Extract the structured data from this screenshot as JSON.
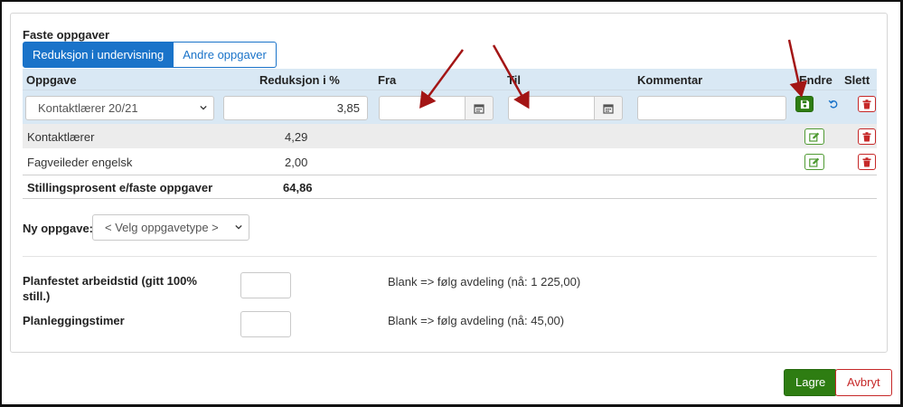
{
  "section": {
    "title": "Faste oppgaver"
  },
  "tabs": [
    {
      "label": "Reduksjon i undervisning",
      "active": true
    },
    {
      "label": "Andre oppgaver",
      "active": false
    }
  ],
  "table": {
    "headers": {
      "oppgave": "Oppgave",
      "reduksjon": "Reduksjon i %",
      "fra": "Fra",
      "til": "Til",
      "kommentar": "Kommentar",
      "endre": "Endre",
      "slett": "Slett"
    },
    "edit_row": {
      "oppgave_selected": "Kontaktlærer 20/21",
      "reduksjon_value": "3,85",
      "fra_value": "",
      "til_value": "",
      "kommentar_value": ""
    },
    "rows": [
      {
        "oppgave": "Kontaktlærer",
        "reduksjon": "4,29"
      },
      {
        "oppgave": "Fagveileder engelsk",
        "reduksjon": "2,00"
      }
    ],
    "total": {
      "label": "Stillingsprosent e/faste oppgaver",
      "value": "64,86"
    }
  },
  "ny_oppgave": {
    "label": "Ny oppgave:",
    "selected": "< Velg oppgavetype >"
  },
  "planning": [
    {
      "label": "Planfestet arbeidstid (gitt 100% still.)",
      "value": "",
      "hint": "Blank => følg avdeling (nå: 1 225,00)"
    },
    {
      "label": "Planleggingstimer",
      "value": "",
      "hint": "Blank => følg avdeling (nå: 45,00)"
    }
  ],
  "footer": {
    "save_label": "Lagre",
    "cancel_label": "Avbryt"
  },
  "icons": {
    "save": "floppy-icon",
    "undo": "undo-icon",
    "edit": "edit-icon",
    "delete": "trash-icon",
    "calendar": "calendar-icon",
    "dropdown": "chevron-down-icon"
  },
  "colors": {
    "primary": "#1a73c9",
    "header_bg": "#d9e8f4",
    "success": "#2e7d12",
    "danger": "#c62828",
    "annotation_arrow": "#a31515"
  }
}
